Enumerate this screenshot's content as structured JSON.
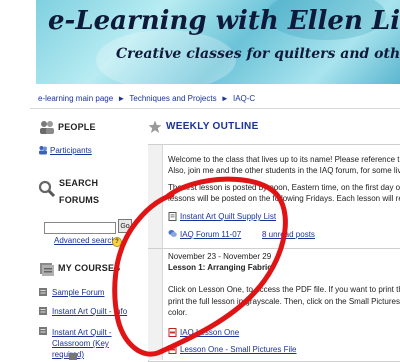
{
  "banner": {
    "title": "e-Learning with Ellen Lindn",
    "subtitle": "Creative classes for quilters and other artists"
  },
  "breadcrumb": {
    "items": [
      "e-learning main page",
      "Techniques and Projects",
      "IAQ-C"
    ],
    "separator": "►"
  },
  "sidebar": {
    "people": {
      "heading": "PEOPLE",
      "participants_label": "Participants"
    },
    "search": {
      "heading_line1": "SEARCH",
      "heading_line2": "FORUMS",
      "input_value": "",
      "go_label": "Go",
      "advanced_label": "Advanced search",
      "help_glyph": "?"
    },
    "courses": {
      "heading": "MY COURSES",
      "items": [
        "Sample Forum",
        "Instant Art Quilt - Info",
        "Instant Art Quilt - Classroom (Key required)"
      ]
    }
  },
  "main": {
    "section_title": "WEEKLY OUTLINE",
    "intro_lines": [
      "Welcome to the class that lives up to its name!  Please reference the supp",
      "Also, join me and the other students in the IAQ forum, for some lively int",
      "",
      "The first lesson is posted by noon, Eastern time, on the first day of class.",
      "lessons will be posted on the following Fridays.  Each lesson will remain a"
    ],
    "resources": [
      {
        "label": "Instant Art Quilt Supply List",
        "icon": "document-icon"
      },
      {
        "label": "IAQ Forum 11-07",
        "icon": "forum-icon"
      }
    ],
    "unread_label": "8 unread posts",
    "week": {
      "dates": "November 23 - November 29",
      "lesson_title": "Lesson 1:  Arranging Fabric",
      "body_lines": [
        "Click on Lesson One, to access the PDF file.  If you want to print the less",
        "print the full lesson in grayscale.  Then, click on the Small Pictures File, b",
        "color."
      ],
      "resources": [
        {
          "label": "IAQ Lesson One",
          "icon": "pdf-icon"
        },
        {
          "label": "Lesson One - Small Pictures File",
          "icon": "pdf-icon"
        }
      ]
    }
  },
  "colors": {
    "link": "#1a3399",
    "annotation": "#e01414",
    "banner_text": "#0f1a3a"
  }
}
